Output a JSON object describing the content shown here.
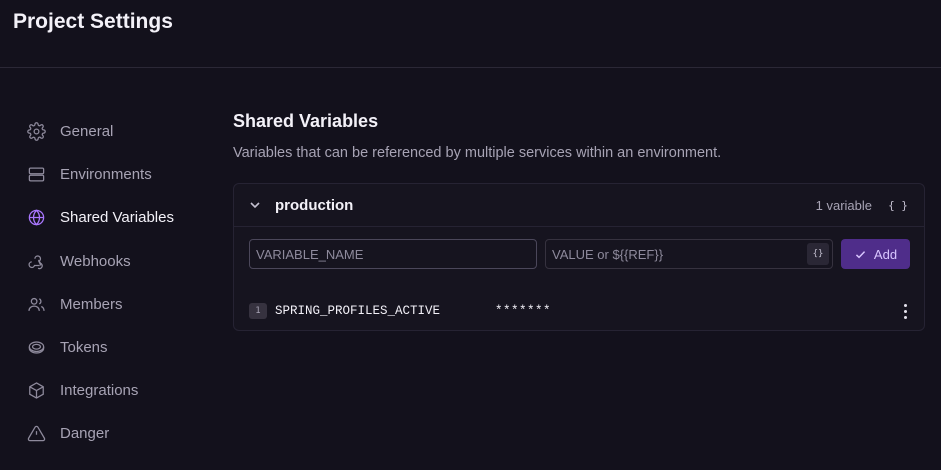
{
  "page": {
    "title": "Project Settings"
  },
  "sidebar": {
    "items": [
      {
        "label": "General",
        "icon": "gear-icon"
      },
      {
        "label": "Environments",
        "icon": "server-icon"
      },
      {
        "label": "Shared Variables",
        "icon": "globe-icon",
        "active": true
      },
      {
        "label": "Webhooks",
        "icon": "webhook-icon"
      },
      {
        "label": "Members",
        "icon": "users-icon"
      },
      {
        "label": "Tokens",
        "icon": "token-icon"
      },
      {
        "label": "Integrations",
        "icon": "cube-icon"
      },
      {
        "label": "Danger",
        "icon": "warning-icon"
      }
    ]
  },
  "section": {
    "title": "Shared Variables",
    "description": "Variables that can be referenced by multiple services within an environment."
  },
  "environment": {
    "name": "production",
    "count_label": "1 variable",
    "json_label": "{ }",
    "name_placeholder": "VARIABLE_NAME",
    "value_placeholder": "VALUE or ${{REF}}",
    "ref_label": "{}",
    "add_label": "Add",
    "variables": [
      {
        "index": "1",
        "name": "SPRING_PROFILES_ACTIVE",
        "value": "*******"
      }
    ]
  },
  "colors": {
    "background": "#13111c",
    "accent": "#a977ff",
    "add_button": "#4f2d8a"
  }
}
